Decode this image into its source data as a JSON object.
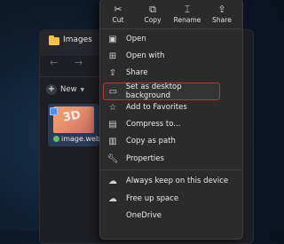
{
  "explorer": {
    "tab_title": "Images",
    "new_label": "New",
    "file": {
      "thumb_text": "3D",
      "name": "image.webp"
    }
  },
  "toolbar": {
    "cut": "Cut",
    "copy": "Copy",
    "rename": "Rename",
    "share": "Share"
  },
  "menu": {
    "items": [
      {
        "label": "Open",
        "icon": "image-icon"
      },
      {
        "label": "Open with",
        "icon": "apps-icon"
      },
      {
        "label": "Share",
        "icon": "share-icon"
      },
      {
        "label": "Set as desktop background",
        "icon": "desktop-icon",
        "highlighted": true
      },
      {
        "label": "Add to Favorites",
        "icon": "star-icon"
      },
      {
        "label": "Compress to...",
        "icon": "archive-icon"
      },
      {
        "label": "Copy as path",
        "icon": "path-icon"
      },
      {
        "label": "Properties",
        "icon": "wrench-icon"
      },
      {
        "label": "Always keep on this device",
        "icon": "cloud-icon"
      },
      {
        "label": "Free up space",
        "icon": "cloud-outline-icon"
      },
      {
        "label": "OneDrive",
        "icon": ""
      }
    ]
  },
  "colors": {
    "highlight_border": "#b23a3a",
    "accent": "#4f8fe8"
  }
}
